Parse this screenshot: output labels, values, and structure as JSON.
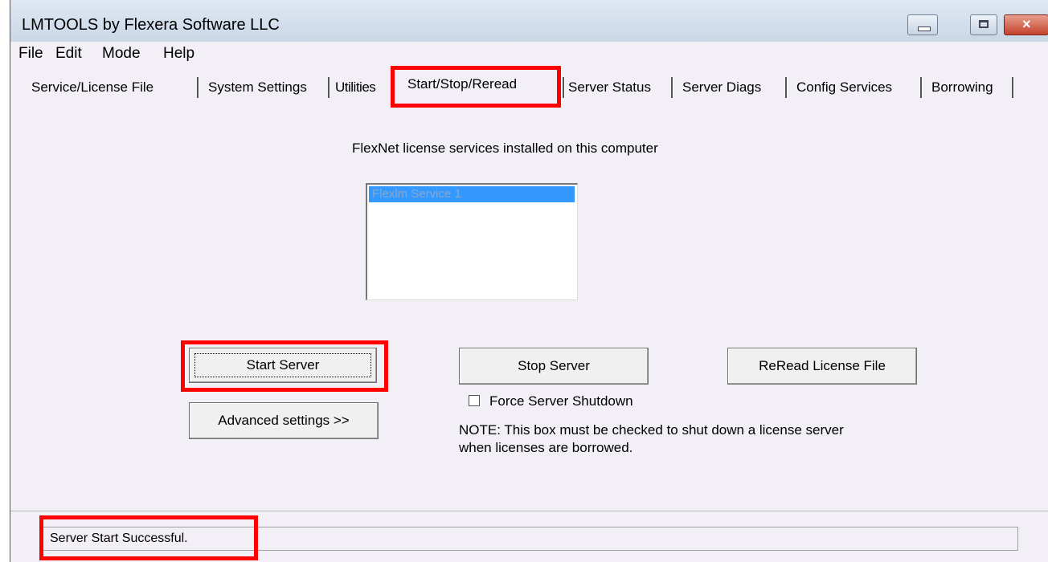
{
  "window": {
    "title": "LMTOOLS by Flexera Software LLC"
  },
  "menu": [
    "File",
    "Edit",
    "Mode",
    "Help"
  ],
  "tabs": [
    "Service/License File",
    "System Settings",
    "Utilities",
    "Start/Stop/Reread",
    "Server Status",
    "Server Diags",
    "Config Services",
    "Borrowing"
  ],
  "active_tab": "Start/Stop/Reread",
  "services": {
    "heading": "FlexNet license services installed on this computer",
    "items": [
      "Flexlm Service 1"
    ],
    "selected_index": 0
  },
  "buttons": {
    "start": "Start Server",
    "stop": "Stop Server",
    "reread": "ReRead License File",
    "advanced": "Advanced settings >>"
  },
  "force_shutdown": {
    "label": "Force Server Shutdown",
    "checked": false
  },
  "note": {
    "line1": "NOTE:  This box must be checked to shut down a license server",
    "line2": "when licenses are borrowed."
  },
  "status": "Server Start Successful.",
  "colors": {
    "highlight": "#ff0000",
    "selection": "#3399ff"
  },
  "icons": [
    "minimize-icon",
    "maximize-icon",
    "close-icon"
  ]
}
